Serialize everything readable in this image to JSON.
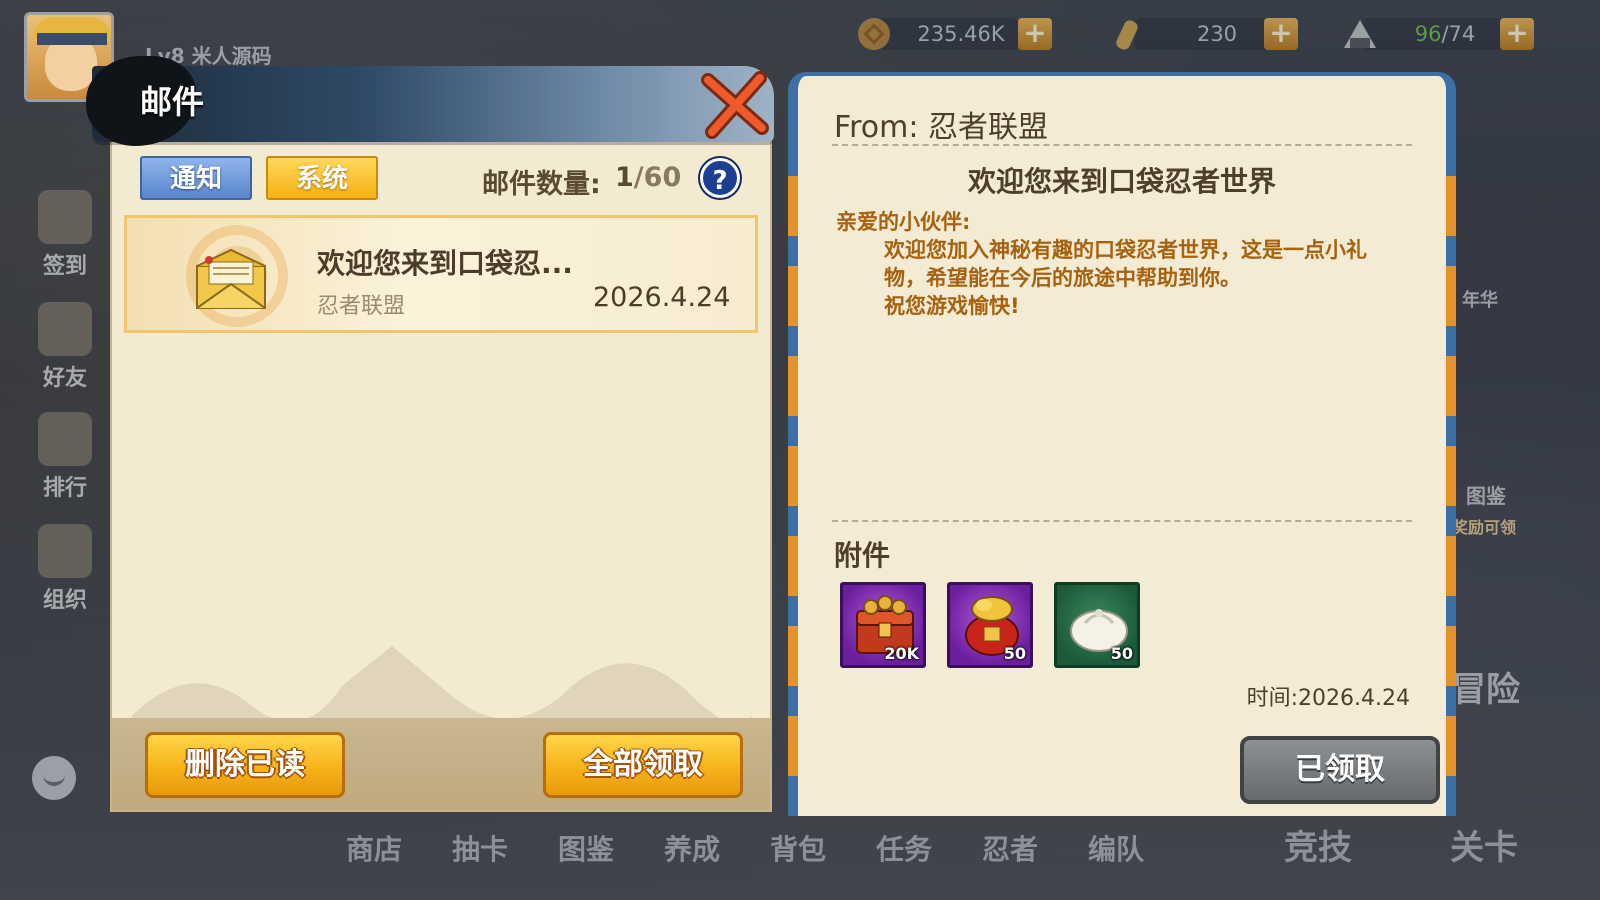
{
  "player": {
    "level": "Lv8 米人源码"
  },
  "resources": {
    "coins": "235.46K",
    "scrolls": "230",
    "stamina_current": "96",
    "stamina_max": "/74"
  },
  "side_menu": [
    "签到",
    "好友",
    "排行",
    "组织"
  ],
  "bottom_nav": [
    "商店",
    "抽卡",
    "图鉴",
    "养成",
    "背包",
    "任务",
    "忍者",
    "编队"
  ],
  "bottom_big": [
    "竞技",
    "关卡"
  ],
  "right_deco": [
    "图鉴",
    "冒险",
    "年华",
    "奖励可领"
  ],
  "mail_panel": {
    "title": "邮件",
    "tabs": [
      "通知",
      "系统"
    ],
    "count_label": "邮件数量:",
    "count_current": "1",
    "count_max": "/60",
    "help": "?",
    "items": [
      {
        "subject": "欢迎您来到口袋忍...",
        "sender": "忍者联盟",
        "date": "2026.4.24"
      }
    ],
    "delete_read": "删除已读",
    "claim_all": "全部领取"
  },
  "detail": {
    "from": "From: 忍者联盟",
    "subject": "欢迎您来到口袋忍者世界",
    "greeting": "亲爱的小伙伴:",
    "body": "欢迎您加入神秘有趣的口袋忍者世界，这是一点小礼物，希望能在今后的旅途中帮助到你。",
    "closing": "祝您游戏愉快!",
    "attachments_label": "附件",
    "attachments": [
      {
        "icon": "treasure-chest-icon",
        "count": "20K"
      },
      {
        "icon": "lucky-bag-icon",
        "count": "50"
      },
      {
        "icon": "steamed-bun-icon",
        "count": "50"
      }
    ],
    "time": "时间:2026.4.24",
    "claimed": "已领取"
  },
  "colors": {
    "accent_orange": "#f7b31a",
    "tab_blue": "#5a86cc",
    "panel_border_blue": "#3b6fa6",
    "body_text": "#a6620f"
  }
}
